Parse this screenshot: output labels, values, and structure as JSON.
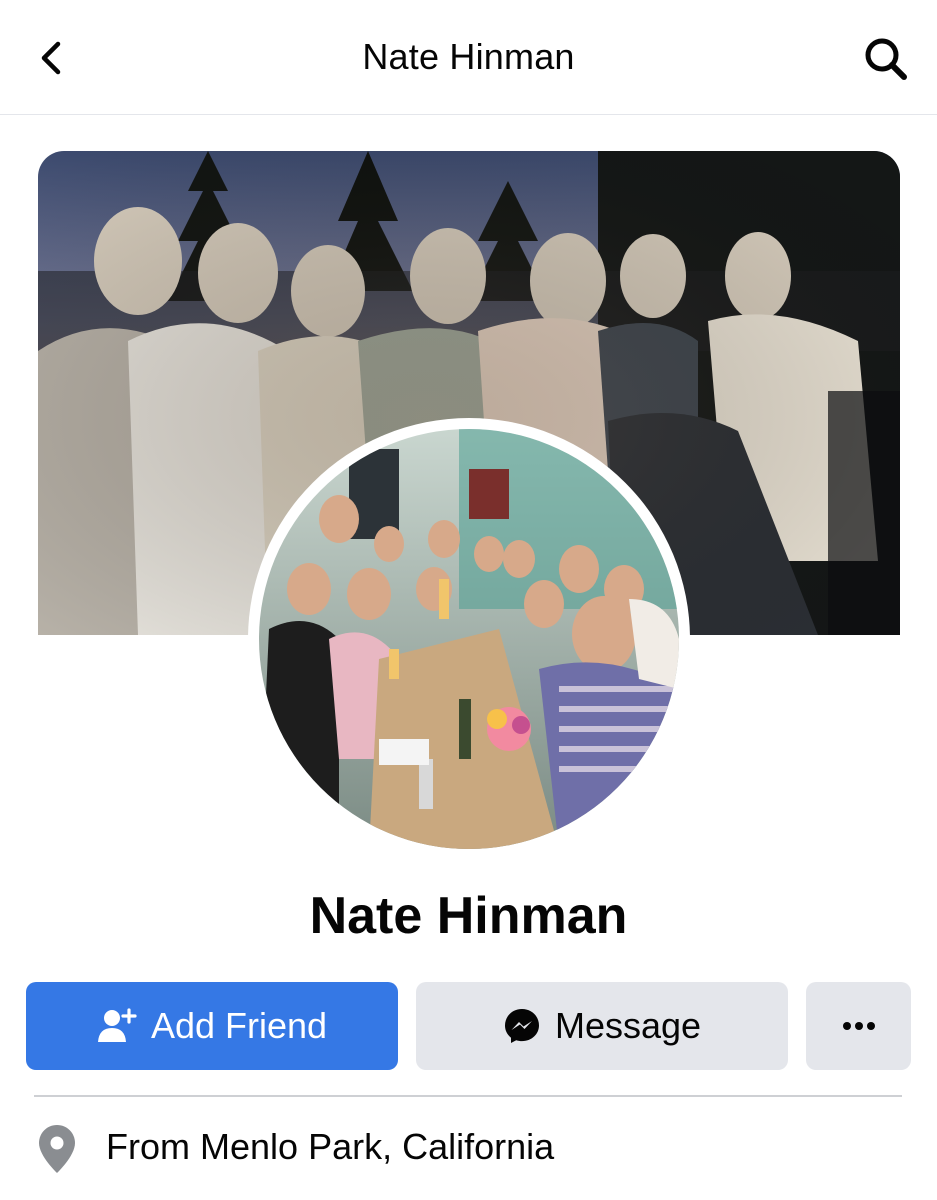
{
  "header": {
    "title": "Nate Hinman",
    "back_icon": "chevron-left-icon",
    "search_icon": "search-icon"
  },
  "profile": {
    "name": "Nate Hinman",
    "cover_photo": "group-photo-outdoors-at-dusk",
    "profile_photo": "group-photo-dinner-table"
  },
  "actions": {
    "add_friend_label": "Add Friend",
    "add_friend_icon": "add-person-icon",
    "message_label": "Message",
    "message_icon": "messenger-icon",
    "more_icon": "more-dots-icon"
  },
  "details": {
    "from_prefix": "From",
    "from_location": "Menlo Park, California",
    "from_icon": "location-pin-icon"
  },
  "colors": {
    "primary": "#3578e5",
    "secondary_button": "#e4e6eb",
    "text": "#050505",
    "icon_gray": "#8a8d91"
  }
}
